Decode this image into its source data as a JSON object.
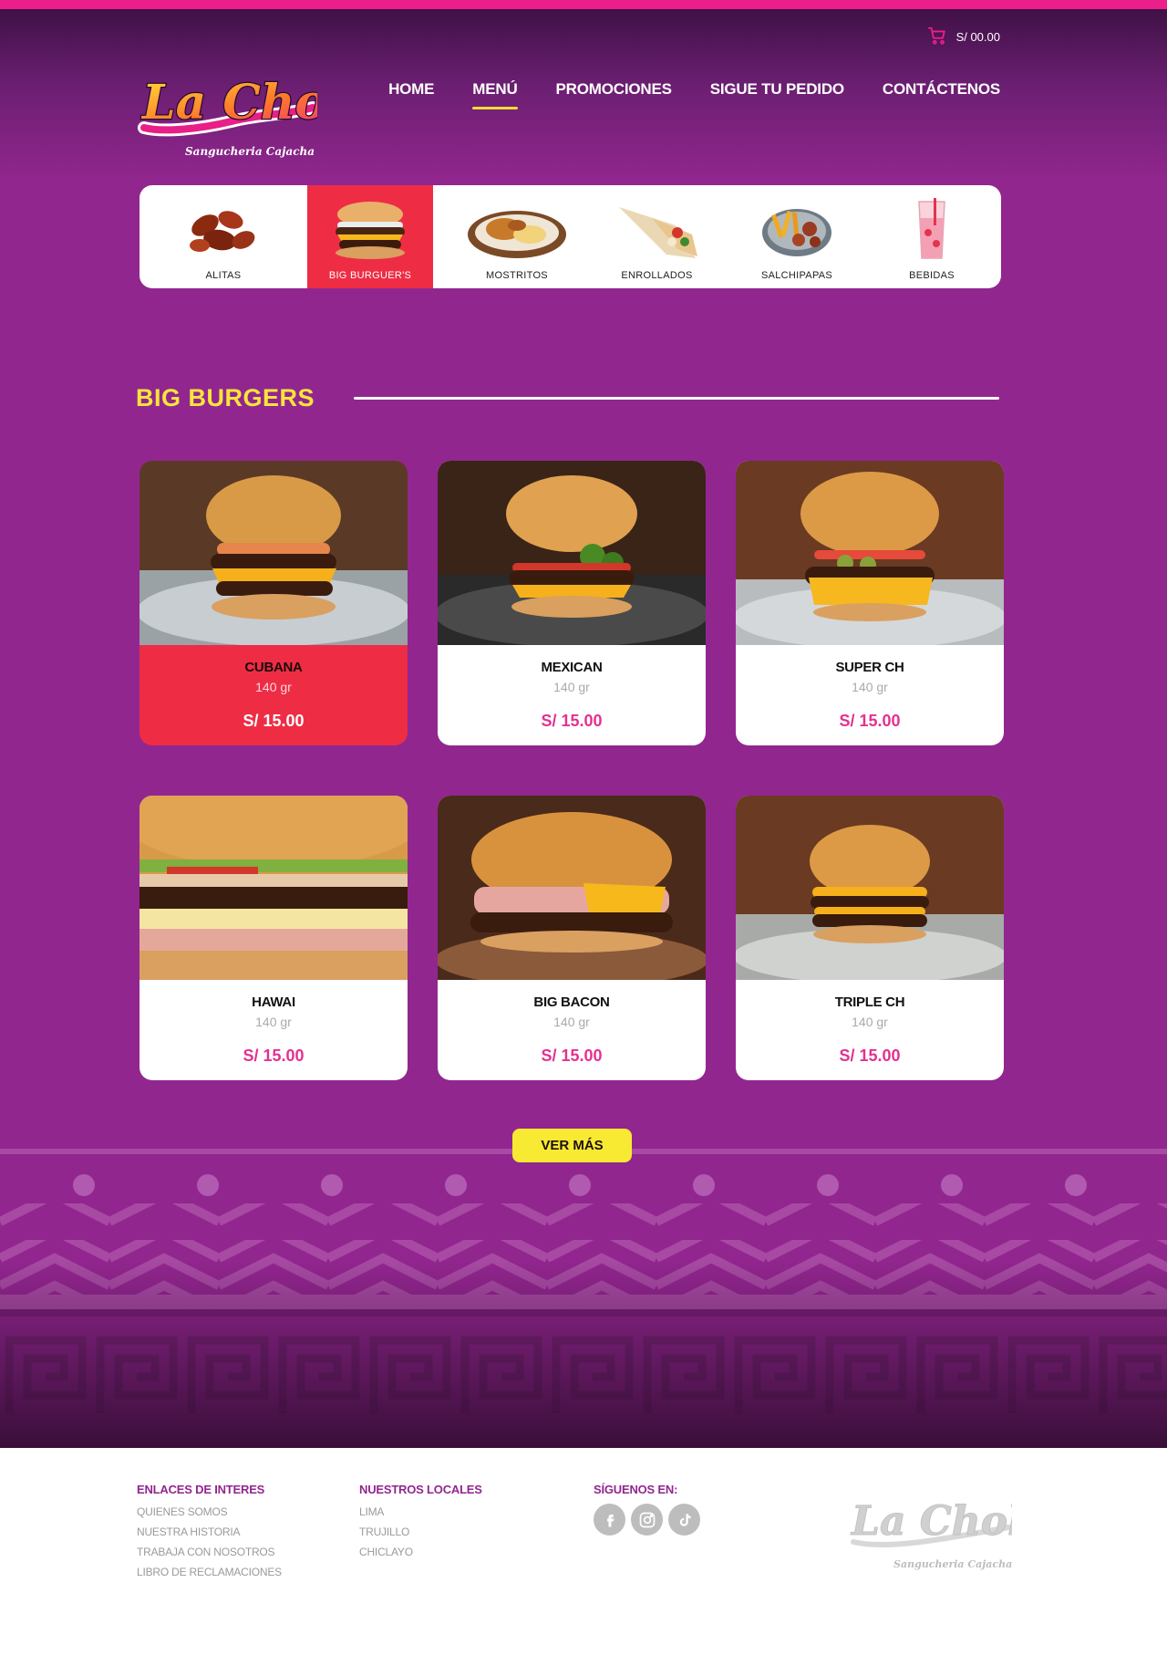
{
  "brand": {
    "name": "La Chola",
    "tagline": "Sangucheria Cajacha",
    "colors": {
      "primary": "#92268f",
      "accent": "#ec1e8c",
      "yellow": "#f8e63a",
      "red": "#ee2d45"
    }
  },
  "header": {
    "cart_total": "S/ 00.00",
    "nav": [
      "HOME",
      "MENÚ",
      "PROMOCIONES",
      "SIGUE TU PEDIDO",
      "CONTÁCTENOS"
    ],
    "active_nav": "MENÚ"
  },
  "categories": [
    {
      "label": "ALITAS",
      "icon": "chicken-wings-icon"
    },
    {
      "label": "BIG BURGUER'S",
      "icon": "burger-icon",
      "active": true
    },
    {
      "label": "MOSTRITOS",
      "icon": "plate-icon"
    },
    {
      "label": "ENROLLADOS",
      "icon": "wrap-icon"
    },
    {
      "label": "SALCHIPAPAS",
      "icon": "fries-sausage-icon"
    },
    {
      "label": "BEBIDAS",
      "icon": "drink-icon"
    }
  ],
  "section": {
    "title": "BIG BURGERS"
  },
  "products": [
    {
      "name": "CUBANA",
      "weight": "140 gr",
      "price": "S/ 15.00",
      "active": true
    },
    {
      "name": "MEXICAN",
      "weight": "140 gr",
      "price": "S/ 15.00"
    },
    {
      "name": "SUPER CH",
      "weight": "140 gr",
      "price": "S/ 15.00"
    },
    {
      "name": "HAWAI",
      "weight": "140 gr",
      "price": "S/ 15.00"
    },
    {
      "name": "BIG BACON",
      "weight": "140 gr",
      "price": "S/ 15.00"
    },
    {
      "name": "TRIPLE CH",
      "weight": "140 gr",
      "price": "S/ 15.00"
    }
  ],
  "ver_mas": "VER MÁS",
  "footer": {
    "col1": {
      "title": "ENLACES DE INTERES",
      "links": [
        "QUIENES SOMOS",
        "NUESTRA HISTORIA",
        "TRABAJA CON NOSOTROS",
        "LIBRO DE  RECLAMACIONES"
      ]
    },
    "col2": {
      "title": "NUESTROS LOCALES",
      "links": [
        "LIMA",
        "TRUJILLO",
        "CHICLAYO"
      ]
    },
    "col3": {
      "title": "SÍGUENOS EN:",
      "icons": [
        "facebook-icon",
        "instagram-icon",
        "tiktok-icon"
      ]
    }
  }
}
